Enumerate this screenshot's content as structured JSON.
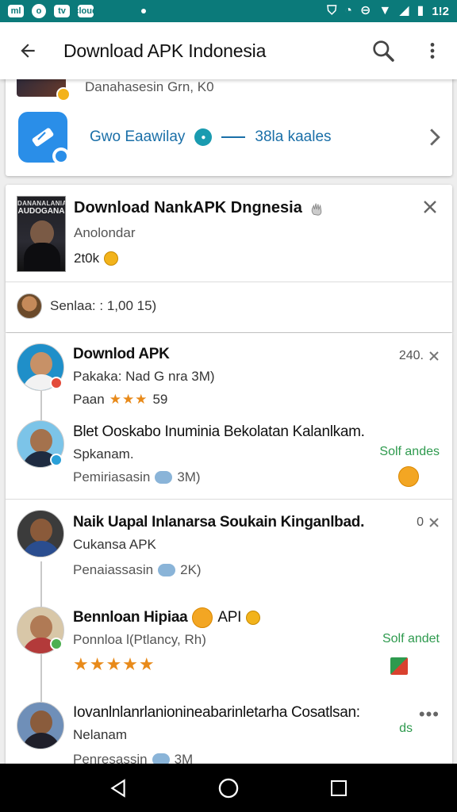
{
  "status_bar": {
    "left_icons": [
      "ml",
      "o",
      "tv",
      "cloud"
    ],
    "time": "1!2"
  },
  "app_bar": {
    "title": "Download APK Indonesia"
  },
  "top_card": {
    "partial_text": "Danahasesin Grn, K0",
    "link_text_a": "Gwo Eaawilay",
    "link_text_b": "38la kaales"
  },
  "featured": {
    "book_title_line1": "DANANALANIALL",
    "book_title_line2": "AUDOGANA",
    "title": "Download NankAPK Dngnesia",
    "subtitle": "Anolondar",
    "count": "2t0k",
    "user_text": "Senlaa: : 1,00 15)"
  },
  "list": [
    {
      "title": "Downlod APK",
      "line1": "Pakaka: Nad G nra 3M)",
      "line2_prefix": "Paan",
      "stars": "★★★",
      "line2_suffix": "59",
      "right_meta": "240."
    },
    {
      "title": "Blet Ooskabo Inuminia Bekolatan Kalanlkam.",
      "line1": "Spkanam.",
      "line2_prefix": "Pemiriasasin",
      "line2_suffix": "3M)",
      "green": "Solf andes"
    },
    {
      "title": "Naik Uapal Inlanarsa Soukain Kinganlbad.",
      "line1": "Cukansa APK",
      "line2_prefix": "Penaiassasin",
      "line2_suffix": "2K)",
      "right_meta": "0"
    },
    {
      "title": "Bennloan Hipiaa",
      "title_suffix": "API",
      "line1": "Ponnloa l(Ptlancy, Rh)",
      "stars": "★★★★★",
      "green": "Solf andet"
    },
    {
      "title": "Iovanlnlanrlanionineabarinletarha Cosatlsan:",
      "line1": "Nelanam",
      "line2_prefix": "Penresassin",
      "line2_suffix": "3M",
      "green": "ds",
      "more": "•••"
    }
  ],
  "icons": {
    "back": "arrow-left-icon",
    "search": "search-icon",
    "more": "more-vert-icon",
    "close": "close-icon",
    "chevron": "chevron-right-icon",
    "nav_back": "triangle-back-icon",
    "nav_home": "circle-home-icon",
    "nav_recents": "square-recents-icon"
  },
  "colors": {
    "status_bar": "#0b7a7a",
    "link_blue": "#1a6fa8",
    "green": "#2e9a4e",
    "star_orange": "#e88a1a"
  }
}
